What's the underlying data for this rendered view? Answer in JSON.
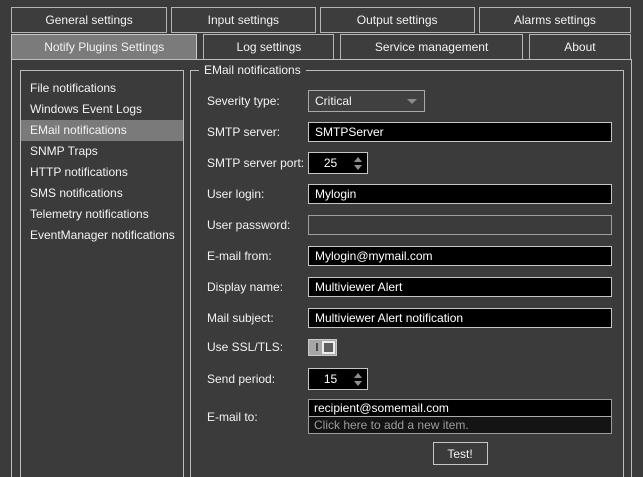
{
  "tabs": {
    "row1": [
      {
        "label": "General settings"
      },
      {
        "label": "Input settings"
      },
      {
        "label": "Output settings"
      },
      {
        "label": "Alarms settings"
      }
    ],
    "row2": [
      {
        "label": "Notify Plugins Settings",
        "selected": true
      },
      {
        "label": "Log settings"
      },
      {
        "label": "Service management"
      },
      {
        "label": "About"
      }
    ]
  },
  "sidebar": {
    "items": [
      {
        "label": "File notifications"
      },
      {
        "label": "Windows Event Logs"
      },
      {
        "label": "EMail notifications",
        "selected": true
      },
      {
        "label": "SNMP Traps"
      },
      {
        "label": "HTTP notifications"
      },
      {
        "label": "SMS notifications"
      },
      {
        "label": "Telemetry notifications"
      },
      {
        "label": "EventManager notifications"
      }
    ]
  },
  "group": {
    "title": "EMail notifications",
    "fields": {
      "severity": {
        "label": "Severity type:",
        "value": "Critical"
      },
      "smtp_server": {
        "label": "SMTP server:",
        "value": "SMTPServer"
      },
      "smtp_port": {
        "label": "SMTP server port:",
        "value": "25"
      },
      "user_login": {
        "label": "User login:",
        "value": "Mylogin"
      },
      "user_password": {
        "label": "User password:",
        "value": ""
      },
      "email_from": {
        "label": "E-mail from:",
        "value": "Mylogin@mymail.com"
      },
      "display_name": {
        "label": "Display name:",
        "value": "Multiviewer Alert"
      },
      "mail_subject": {
        "label": "Mail subject:",
        "value": "Multiviewer Alert notification"
      },
      "use_ssl": {
        "label": "Use SSL/TLS:",
        "state": "off"
      },
      "send_period": {
        "label": "Send period:",
        "value": "15"
      },
      "email_to": {
        "label": "E-mail to:",
        "recipients": [
          "recipient@somemail.com"
        ],
        "placeholder": "Click here to add a new item."
      }
    },
    "test_button_label": "Test!"
  },
  "colors": {
    "background": "#3b3b3b",
    "selected_gray": "#7b7b7b",
    "border_light": "#bdbdbd",
    "input_background": "#000000",
    "text": "#f2f2f2",
    "muted_text": "#9c9c9c"
  }
}
